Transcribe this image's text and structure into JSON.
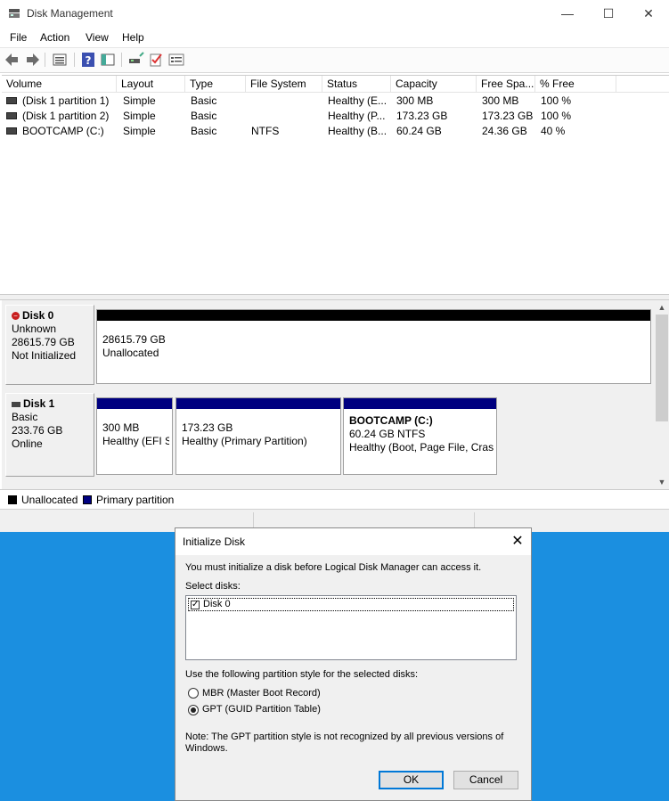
{
  "window": {
    "title": "Disk Management",
    "controls": {
      "minimize": "—",
      "maximize": "☐",
      "close": "✕"
    }
  },
  "menu": [
    "File",
    "Action",
    "View",
    "Help"
  ],
  "volume_list": {
    "columns": [
      "Volume",
      "Layout",
      "Type",
      "File System",
      "Status",
      "Capacity",
      "Free Spa...",
      "% Free"
    ],
    "rows": [
      {
        "volume": "(Disk 1 partition 1)",
        "layout": "Simple",
        "type": "Basic",
        "fs": "",
        "status": "Healthy (E...",
        "capacity": "300 MB",
        "free": "300 MB",
        "pct": "100 %"
      },
      {
        "volume": "(Disk 1 partition 2)",
        "layout": "Simple",
        "type": "Basic",
        "fs": "",
        "status": "Healthy (P...",
        "capacity": "173.23 GB",
        "free": "173.23 GB",
        "pct": "100 %"
      },
      {
        "volume": "BOOTCAMP (C:)",
        "layout": "Simple",
        "type": "Basic",
        "fs": "NTFS",
        "status": "Healthy (B...",
        "capacity": "60.24 GB",
        "free": "24.36 GB",
        "pct": "40 %"
      }
    ]
  },
  "disks": [
    {
      "name": "Disk 0",
      "kind": "Unknown",
      "size": "28615.79 GB",
      "state": "Not Initialized",
      "partitions": [
        {
          "line1": "28615.79 GB",
          "line2": "Unallocated"
        }
      ]
    },
    {
      "name": "Disk 1",
      "kind": "Basic",
      "size": "233.76 GB",
      "state": "Online",
      "partitions": [
        {
          "line1": "300 MB",
          "line2": "Healthy (EFI S"
        },
        {
          "line1": "173.23 GB",
          "line2": "Healthy (Primary Partition)"
        },
        {
          "title": "BOOTCAMP  (C:)",
          "line1": "60.24 GB NTFS",
          "line2": "Healthy (Boot, Page File, Crasl"
        }
      ]
    }
  ],
  "legend": {
    "unallocated": "Unallocated",
    "primary": "Primary partition",
    "colors": {
      "unallocated": "#000000",
      "primary": "#000080"
    }
  },
  "dialog": {
    "title": "Initialize Disk",
    "intro": "You must initialize a disk before Logical Disk Manager can access it.",
    "select_label": "Select disks:",
    "disk_item": "Disk 0",
    "style_label": "Use the following partition style for the selected disks:",
    "mbr": "MBR (Master Boot Record)",
    "gpt": "GPT (GUID Partition Table)",
    "note_line1": "Note: The GPT partition style is not recognized by all previous versions of",
    "note_line2": "Windows.",
    "ok": "OK",
    "cancel": "Cancel"
  }
}
